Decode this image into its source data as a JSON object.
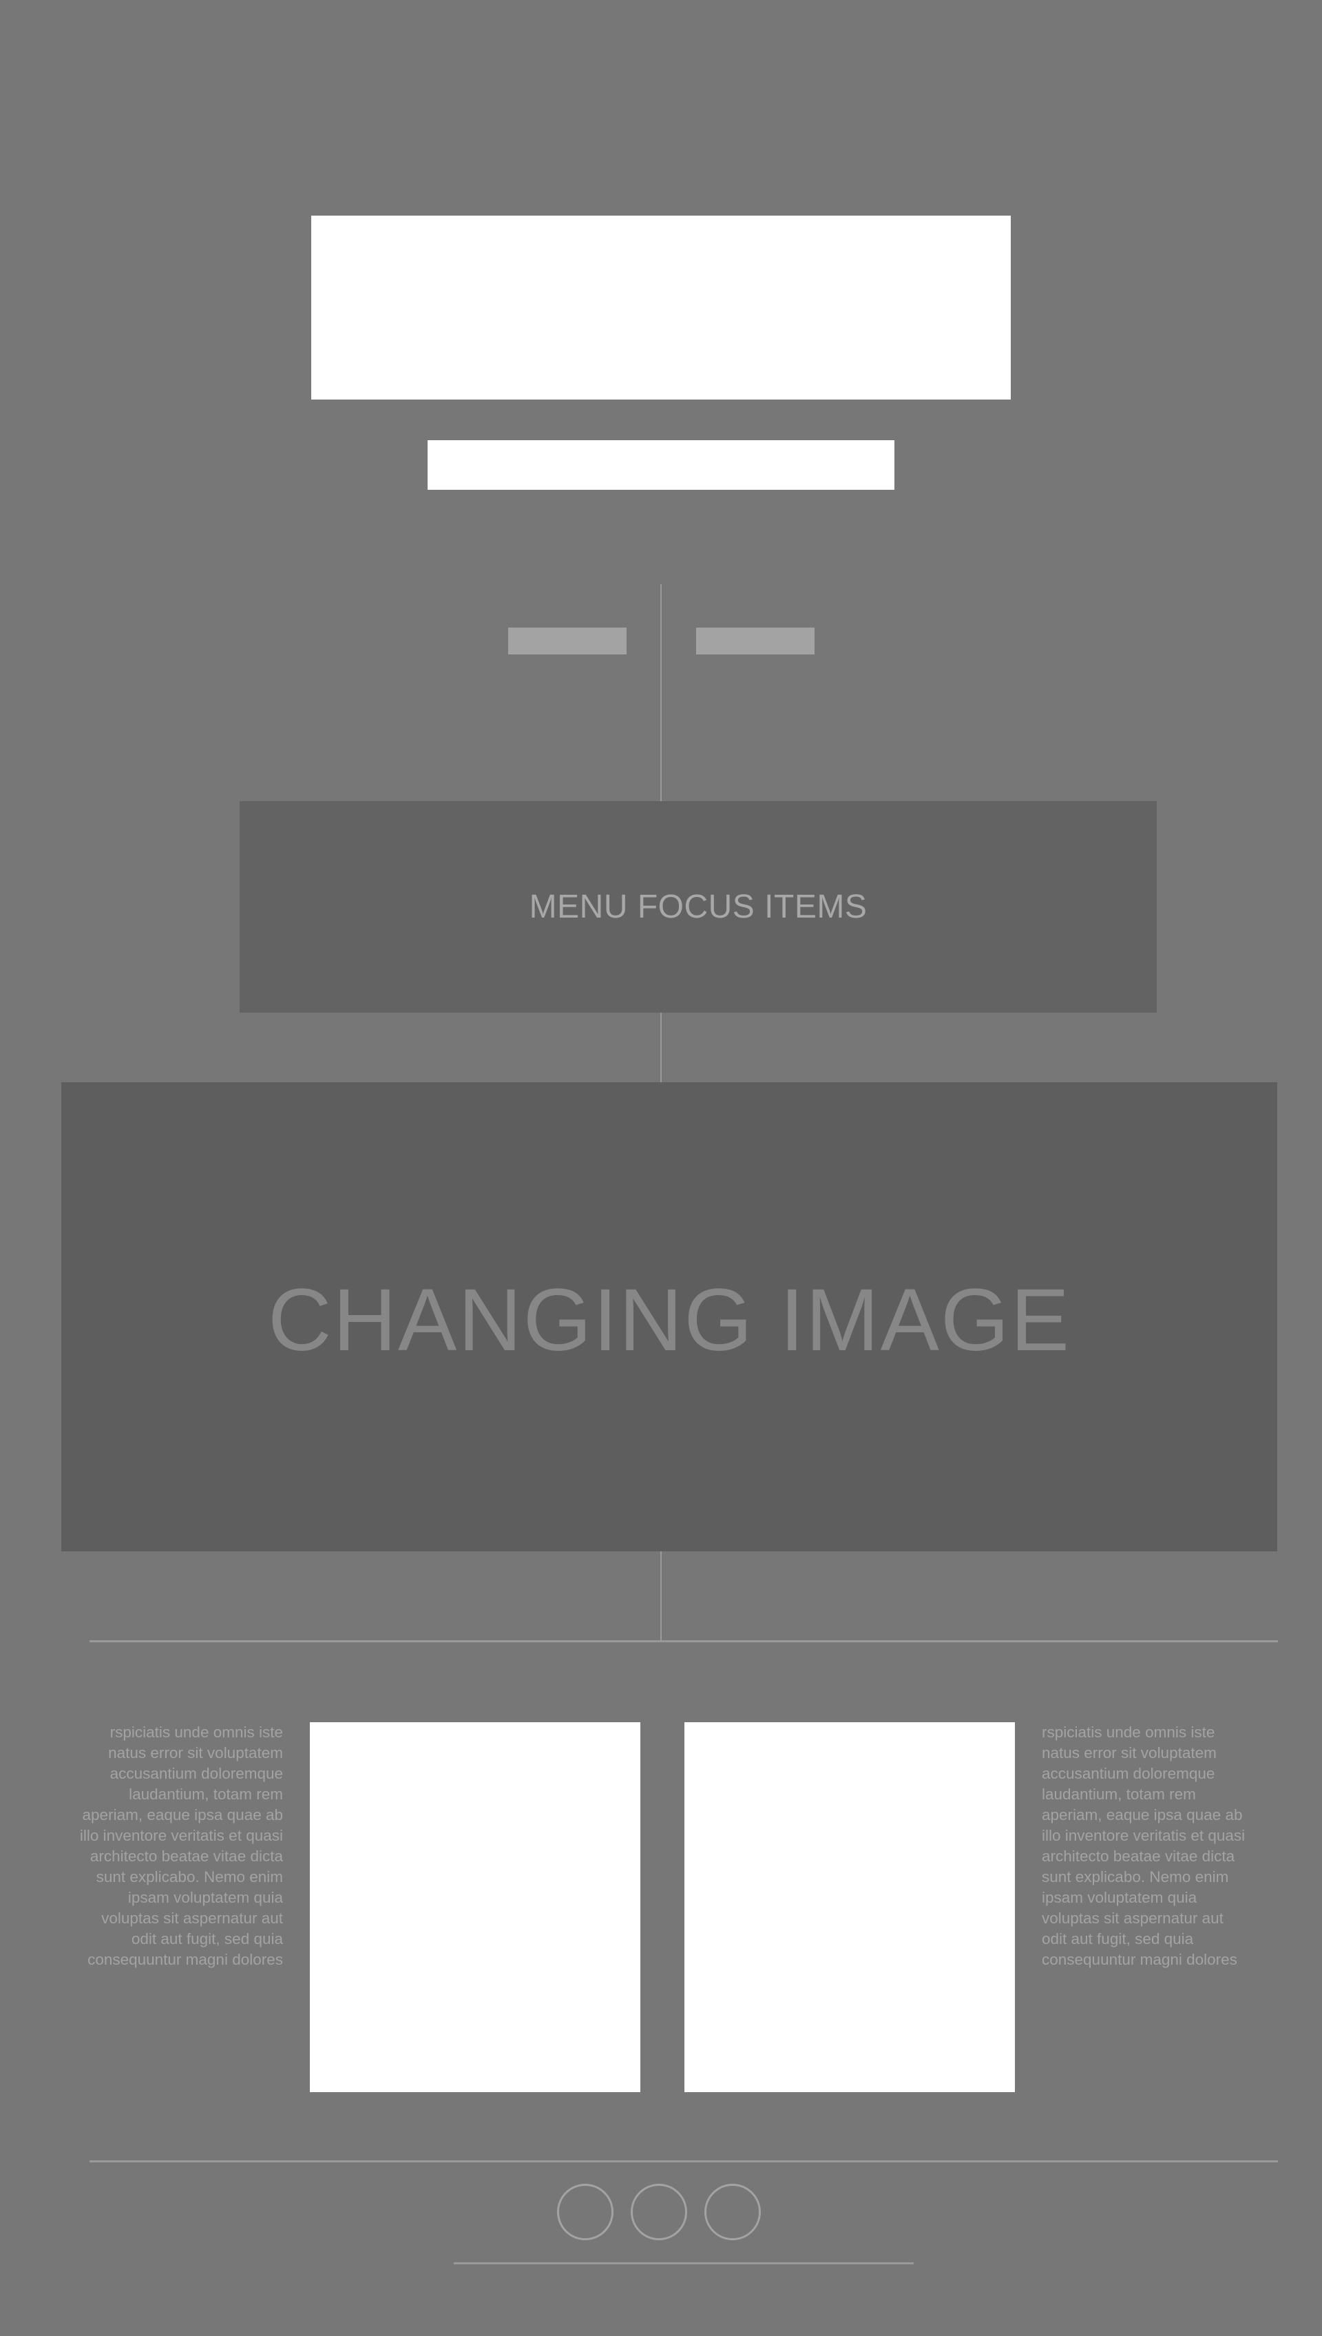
{
  "header": {
    "logo_placeholder": "",
    "tagline_placeholder": ""
  },
  "nav": {
    "left_button_label": "",
    "right_button_label": ""
  },
  "menu_focus": {
    "label": "MENU FOCUS ITEMS"
  },
  "hero": {
    "label": "CHANGING IMAGE"
  },
  "feature": {
    "left_text": "rspiciatis unde omnis iste\nnatus error sit voluptatem\naccusantium doloremque\nlaudantium, totam rem\naperiam, eaque ipsa quae ab\nillo inventore veritatis et quasi\narchitecto beatae vitae dicta\nsunt explicabo. Nemo enim\nipsam voluptatem quia\nvoluptas sit aspernatur aut\nodit aut fugit, sed quia\nconsequuntur magni dolores",
    "right_text": "rspiciatis unde omnis iste\nnatus error sit voluptatem\naccusantium doloremque\nlaudantium, totam rem\naperiam, eaque ipsa quae ab\nillo inventore veritatis et quasi\narchitecto beatae vitae dicta\nsunt explicabo. Nemo enim\nipsam voluptatem quia\nvoluptas sit aspernatur aut\nodit aut fugit, sed quia\nconsequuntur magni dolores"
  },
  "footer": {
    "icons": [
      "social-icon-1",
      "social-icon-2",
      "social-icon-3"
    ]
  },
  "colors": {
    "background": "#777777",
    "menu_panel": "#636363",
    "hero_panel": "#5e5e5e",
    "placeholder": "#ffffff",
    "line": "#9a9a9a"
  }
}
